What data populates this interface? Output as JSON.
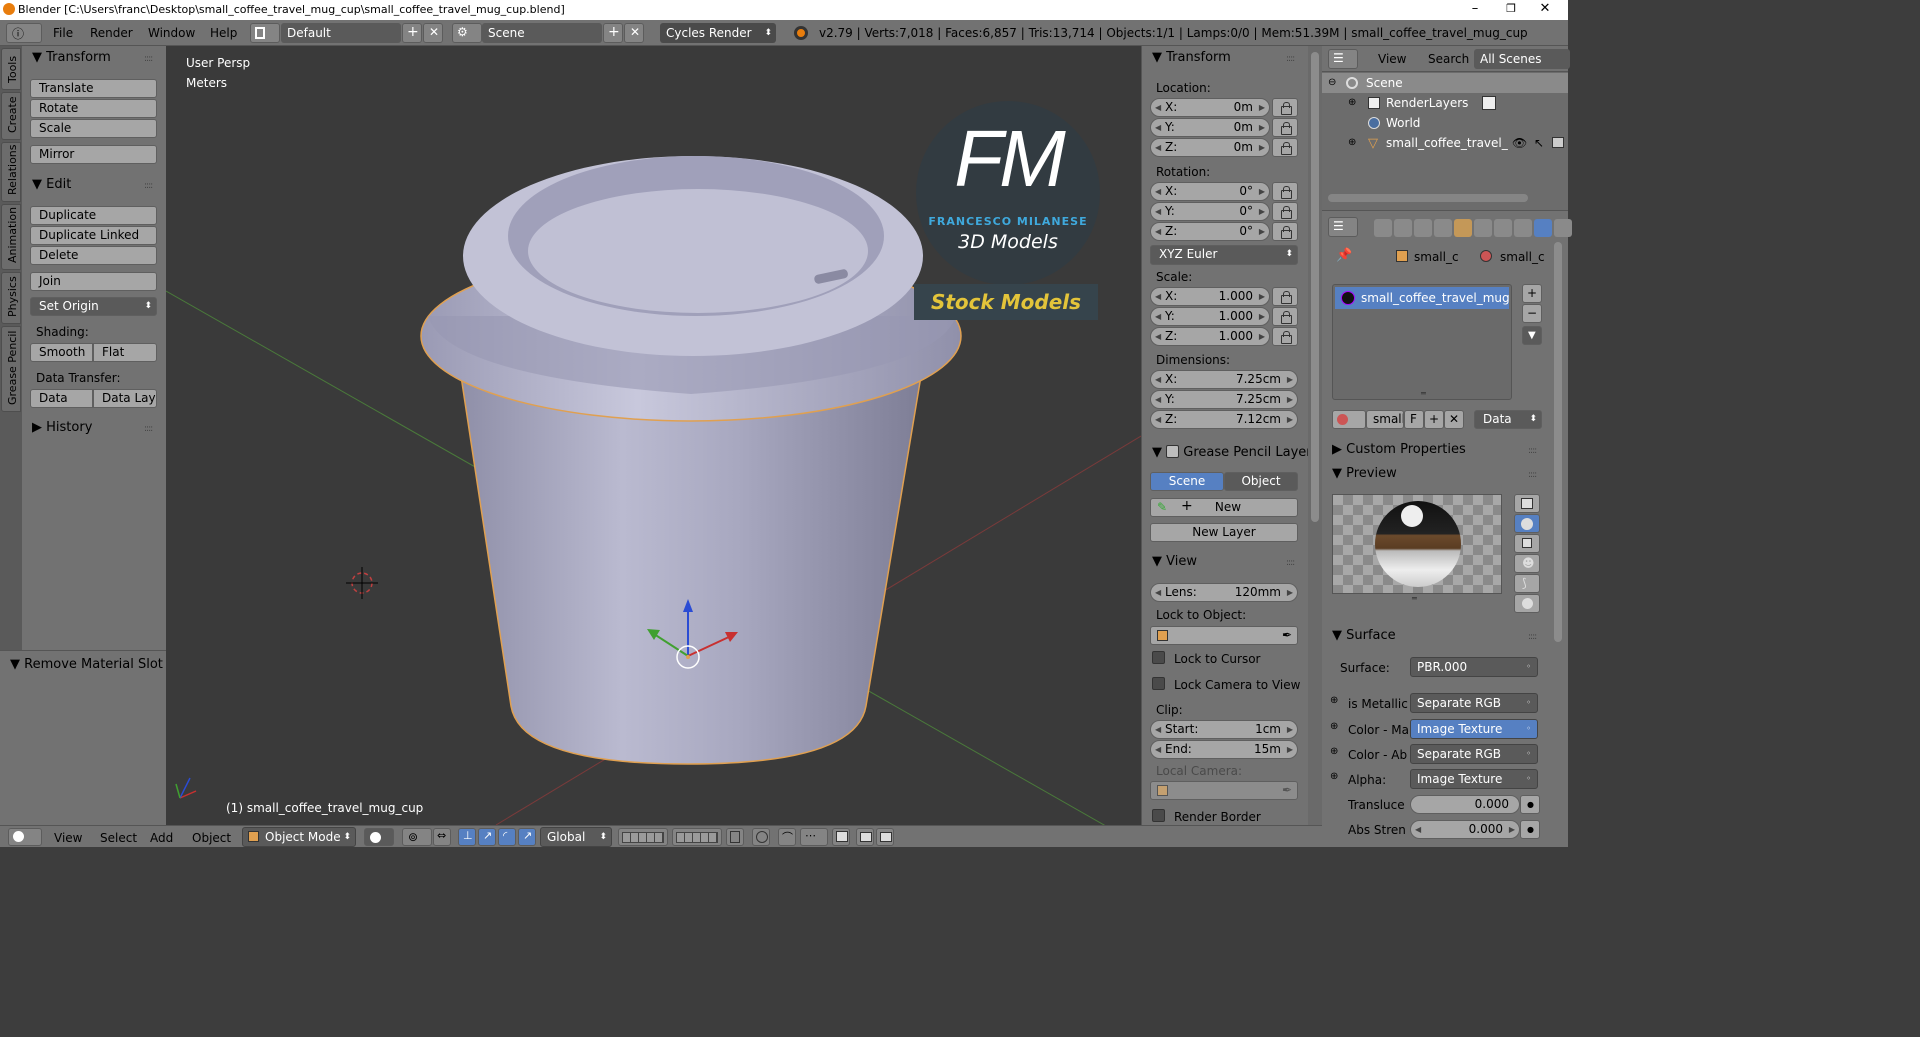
{
  "window": {
    "title": "Blender [C:\\Users\\franc\\Desktop\\small_coffee_travel_mug_cup\\small_coffee_travel_mug_cup.blend]",
    "minimize": "–",
    "maximize": "❐",
    "close": "✕"
  },
  "info_header": {
    "menus": [
      "File",
      "Render",
      "Window",
      "Help"
    ],
    "layout": "Default",
    "scene": "Scene",
    "engine": "Cycles Render",
    "stats": "v2.79 | Verts:7,018 | Faces:6,857 | Tris:13,714 | Objects:1/1 | Lamps:0/0 | Mem:51.39M | small_coffee_travel_mug_cup"
  },
  "left_tabs": [
    "Tools",
    "Create",
    "Relations",
    "Animation",
    "Physics",
    "Grease Pencil"
  ],
  "tool_shelf": {
    "transform_title": "Transform",
    "translate": "Translate",
    "rotate": "Rotate",
    "scale": "Scale",
    "mirror": "Mirror",
    "edit_title": "Edit",
    "duplicate": "Duplicate",
    "duplicate_linked": "Duplicate Linked",
    "delete": "Delete",
    "join": "Join",
    "set_origin": "Set Origin",
    "shading_label": "Shading:",
    "smooth": "Smooth",
    "flat": "Flat",
    "data_transfer_label": "Data Transfer:",
    "data": "Data",
    "data_layout": "Data Layo",
    "history_title": "History",
    "last_op_title": "Remove Material Slot"
  },
  "viewport": {
    "view_name": "User Persp",
    "units": "Meters",
    "object_label": "(1) small_coffee_travel_mug_cup",
    "watermark_top": "FM",
    "watermark_name": "FRANCESCO MILANESE",
    "watermark_sub": "3D Models",
    "watermark_banner": "Stock Models",
    "colors": {
      "bg": "#3a3a3a",
      "mug": "#b9b9cf",
      "watermark_blue": "#3fa9dd",
      "banner_text": "#e3c43a",
      "x_axis": "#b8403d",
      "y_axis": "#4a9c3a",
      "z_axis": "#2b4cd4"
    }
  },
  "n_panel": {
    "transform_title": "Transform",
    "location_label": "Location:",
    "loc": [
      {
        "k": "X:",
        "v": "0m"
      },
      {
        "k": "Y:",
        "v": "0m"
      },
      {
        "k": "Z:",
        "v": "0m"
      }
    ],
    "rotation_label": "Rotation:",
    "rot": [
      {
        "k": "X:",
        "v": "0°"
      },
      {
        "k": "Y:",
        "v": "0°"
      },
      {
        "k": "Z:",
        "v": "0°"
      }
    ],
    "rotation_mode": "XYZ Euler",
    "scale_label": "Scale:",
    "scale": [
      {
        "k": "X:",
        "v": "1.000"
      },
      {
        "k": "Y:",
        "v": "1.000"
      },
      {
        "k": "Z:",
        "v": "1.000"
      }
    ],
    "dimensions_label": "Dimensions:",
    "dims": [
      {
        "k": "X:",
        "v": "7.25cm"
      },
      {
        "k": "Y:",
        "v": "7.25cm"
      },
      {
        "k": "Z:",
        "v": "7.12cm"
      }
    ],
    "grease_title": "Grease Pencil Layer",
    "gp_scene": "Scene",
    "gp_object": "Object",
    "gp_new": "New",
    "gp_new_layer": "New Layer",
    "view_title": "View",
    "lens_k": "Lens:",
    "lens_v": "120mm",
    "lock_object_label": "Lock to Object:",
    "lock_cursor": "Lock to Cursor",
    "lock_camera": "Lock Camera to View",
    "clip_label": "Clip:",
    "clip_start_k": "Start:",
    "clip_start_v": "1cm",
    "clip_end_k": "End:",
    "clip_end_v": "15m",
    "local_camera_label": "Local Camera:",
    "render_border": "Render Border"
  },
  "outliner": {
    "view": "View",
    "search": "Search",
    "filter": "All Scenes",
    "rows": [
      "Scene",
      "RenderLayers",
      "World",
      "small_coffee_travel_mug_cup"
    ]
  },
  "properties": {
    "crumb1": "small_c",
    "crumb2": "small_c",
    "material_slot": "small_coffee_travel_mug...",
    "mat_name": "small",
    "mat_fake": "F",
    "link": "Data",
    "custom_props": "Custom Properties",
    "preview": "Preview",
    "surface_title": "Surface",
    "surface_label": "Surface:",
    "surface_value": "PBR.000",
    "inputs": [
      {
        "k": "is Metallic",
        "v": "Separate RGB"
      },
      {
        "k": "Color - Ma",
        "v": "Image Texture"
      },
      {
        "k": "Color - Ab",
        "v": "Separate RGB"
      },
      {
        "k": "Alpha:",
        "v": "Image Texture"
      }
    ],
    "translucent_k": "Transluce",
    "translucent_v": "0.000",
    "abs_k": "Abs Stren",
    "abs_v": "0.000"
  },
  "bottom_bar": {
    "view": "View",
    "select": "Select",
    "add": "Add",
    "object": "Object",
    "mode": "Object Mode",
    "orientation": "Global"
  }
}
